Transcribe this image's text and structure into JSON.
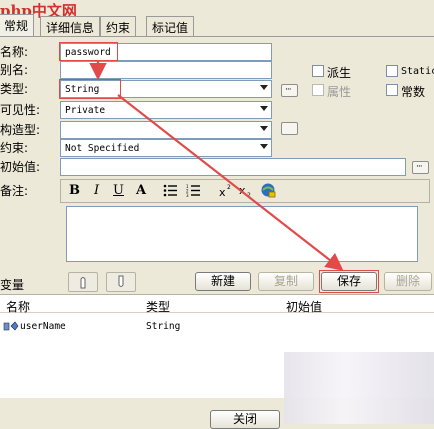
{
  "logo": "php中文网",
  "tabs": [
    "常规",
    "详细信息",
    "约束",
    "标记值"
  ],
  "form": {
    "name_label": "名称:",
    "name_value": "password",
    "alias_label": "别名:",
    "alias_value": "",
    "type_label": "类型:",
    "type_value": "String",
    "visibility_label": "可见性:",
    "visibility_value": "Private",
    "stereotype_label": "构造型:",
    "stereotype_value": "",
    "constraint_label": "约束:",
    "constraint_value": "Not Specified",
    "initial_label": "初始值:",
    "initial_value": "",
    "notes_label": "备注:"
  },
  "checkboxes": {
    "derived": "派生",
    "static": "Static",
    "property": "属性",
    "constant": "常数"
  },
  "toolbar": {
    "bold": "B",
    "italic": "I",
    "underline": "U",
    "font_color": "A"
  },
  "vars_label": "变量",
  "buttons": {
    "new": "新建",
    "copy": "复制",
    "save": "保存",
    "delete": "删除",
    "close": "关闭"
  },
  "table": {
    "headers": [
      "名称",
      "类型",
      "初始值"
    ],
    "rows": [
      {
        "name": "userName",
        "type": "String",
        "initial": ""
      }
    ]
  },
  "colors": {
    "accent_red": "#e24a4a",
    "window_bg": "#ece9d8",
    "field_border": "#7f9db9"
  }
}
